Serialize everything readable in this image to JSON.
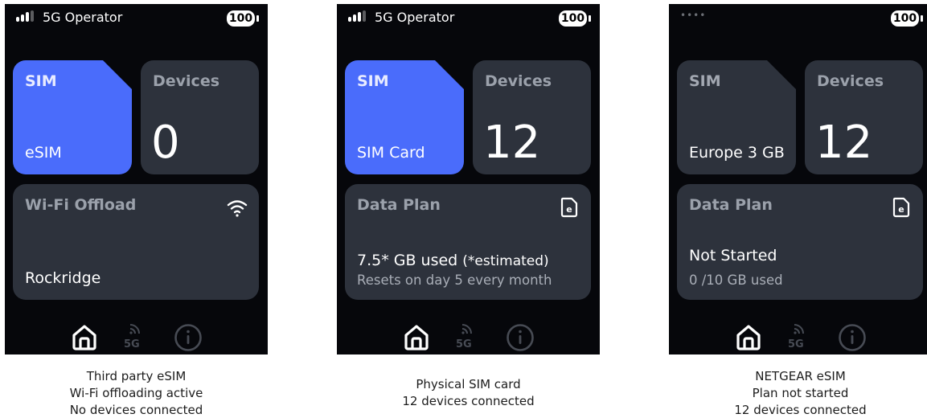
{
  "colors": {
    "sim_active": "#4a6cfb",
    "tile": "#2d323c",
    "panel_bg": "#06070b"
  },
  "screens": [
    {
      "status": {
        "operator": "5G Operator",
        "battery": "100",
        "signal_icon": "signal-bars-icon"
      },
      "sim": {
        "title": "SIM",
        "value": "eSIM",
        "state": "active"
      },
      "devices": {
        "title": "Devices",
        "count": "0"
      },
      "card": {
        "title": "Wi-Fi Offload",
        "icon": "wifi-icon",
        "value": "Rockridge"
      },
      "nav": {
        "home_icon": "home-icon",
        "network": "5G",
        "info_icon": "info-icon"
      },
      "caption": [
        "Third party eSIM",
        "Wi-Fi offloading active",
        "No devices connected"
      ]
    },
    {
      "status": {
        "operator": "5G Operator",
        "battery": "100",
        "signal_icon": "signal-bars-icon"
      },
      "sim": {
        "title": "SIM",
        "value": "SIM Card",
        "state": "active"
      },
      "devices": {
        "title": "Devices",
        "count": "12"
      },
      "card": {
        "title": "Data Plan",
        "icon": "esim-file-icon",
        "usage": "7.5* GB used",
        "usage_note": "(*estimated)",
        "detail": "Resets on day 5 every month"
      },
      "nav": {
        "home_icon": "home-icon",
        "network": "5G",
        "info_icon": "info-icon"
      },
      "caption": [
        "Physical SIM card",
        "12 devices connected"
      ]
    },
    {
      "status": {
        "operator": "",
        "battery": "100",
        "signal_icon": "no-signal-dots-icon",
        "signal_dots": "••••"
      },
      "sim": {
        "title": "SIM",
        "value": "Europe 3 GB",
        "state": "inactive"
      },
      "devices": {
        "title": "Devices",
        "count": "12"
      },
      "card": {
        "title": "Data Plan",
        "icon": "esim-file-icon",
        "usage": "Not Started",
        "detail": "0 /10 GB used"
      },
      "nav": {
        "home_icon": "home-icon",
        "network": "5G",
        "info_icon": "info-icon"
      },
      "caption": [
        "NETGEAR eSIM",
        "Plan not started",
        "12 devices connected"
      ]
    }
  ]
}
